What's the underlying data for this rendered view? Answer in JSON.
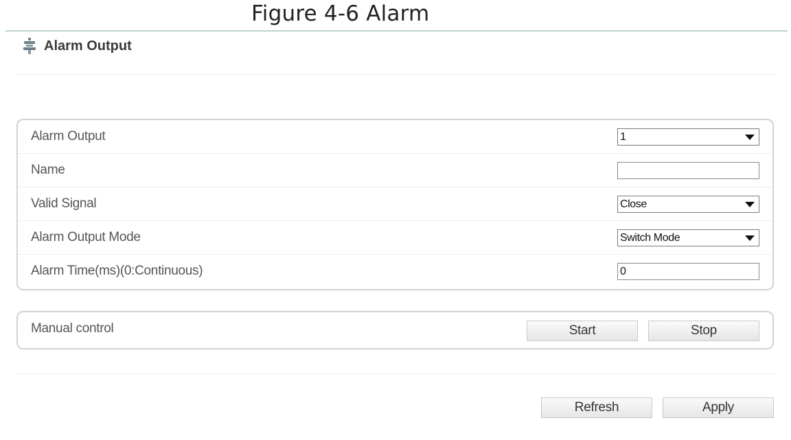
{
  "caption": {
    "text": "Figure 4-6 Alarm"
  },
  "header": {
    "title": "Alarm Output",
    "icon": "alarm-output-icon"
  },
  "settings": {
    "alarm_output": {
      "label": "Alarm Output",
      "value": "1"
    },
    "name": {
      "label": "Name",
      "value": ""
    },
    "valid_signal": {
      "label": "Valid Signal",
      "value": "Close"
    },
    "alarm_output_mode": {
      "label": "Alarm Output Mode",
      "value": "Switch Mode"
    },
    "alarm_time": {
      "label": "Alarm Time(ms)(0:Continuous)",
      "value": "0"
    }
  },
  "manual_control": {
    "label": "Manual control",
    "start_label": "Start",
    "stop_label": "Stop"
  },
  "footer": {
    "refresh_label": "Refresh",
    "apply_label": "Apply"
  }
}
